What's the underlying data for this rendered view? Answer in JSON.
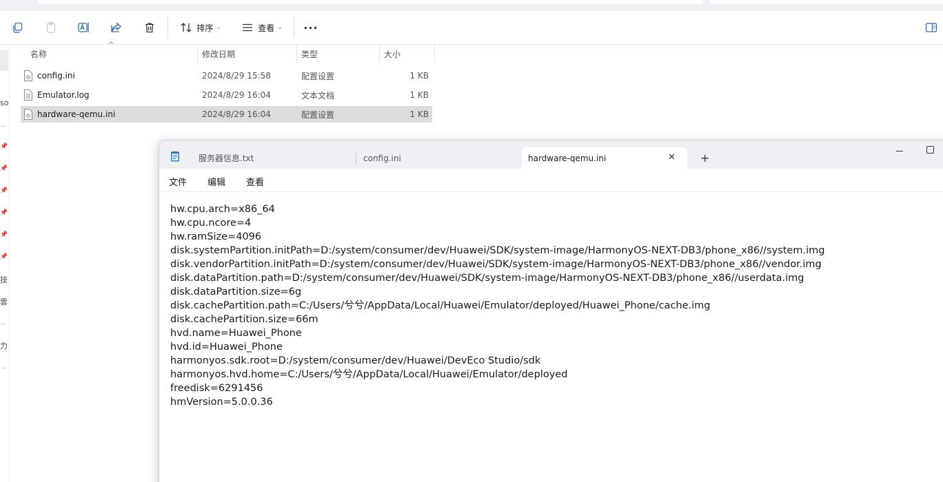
{
  "explorer": {
    "toolbar": {
      "copy_icon": "copy-icon",
      "paste_icon": "paste-icon",
      "rename_icon": "rename-icon",
      "share_icon": "share-icon",
      "delete_icon": "trash-icon",
      "sort_label": "排序",
      "view_label": "查看",
      "more_label": "···"
    },
    "columns": {
      "name": "名称",
      "modified": "修改日期",
      "type": "类型",
      "size": "大小"
    },
    "left_nav_fragments": [
      "so",
      "技",
      "雲",
      "力"
    ],
    "files": [
      {
        "name": "config.ini",
        "modified": "2024/8/29 15:58",
        "type": "配置设置",
        "size": "1 KB",
        "icon": "ini-file-icon",
        "selected": false
      },
      {
        "name": "Emulator.log",
        "modified": "2024/8/29 16:04",
        "type": "文本文档",
        "size": "1 KB",
        "icon": "text-file-icon",
        "selected": false
      },
      {
        "name": "hardware-qemu.ini",
        "modified": "2024/8/29 16:04",
        "type": "配置设置",
        "size": "1 KB",
        "icon": "ini-file-icon",
        "selected": true
      }
    ]
  },
  "notepad": {
    "tabs": [
      {
        "label": "服务器信息.txt",
        "active": false
      },
      {
        "label": "config.ini",
        "active": false
      },
      {
        "label": "hardware-qemu.ini",
        "active": true
      }
    ],
    "close_tab_glyph": "✕",
    "new_tab_glyph": "+",
    "menu": {
      "file": "文件",
      "edit": "编辑",
      "view": "查看"
    },
    "lines": [
      "hw.cpu.arch=x86_64",
      "hw.cpu.ncore=4",
      "hw.ramSize=4096",
      "disk.systemPartition.initPath=D:/system/consumer/dev/Huawei/SDK/system-image/HarmonyOS-NEXT-DB3/phone_x86//system.img",
      "disk.vendorPartition.initPath=D:/system/consumer/dev/Huawei/SDK/system-image/HarmonyOS-NEXT-DB3/phone_x86//vendor.img",
      "disk.dataPartition.path=D:/system/consumer/dev/Huawei/SDK/system-image/HarmonyOS-NEXT-DB3/phone_x86//userdata.img",
      "disk.dataPartition.size=6g",
      "disk.cachePartition.path=C:/Users/兮兮/AppData/Local/Huawei/Emulator/deployed/Huawei_Phone/cache.img",
      "disk.cachePartition.size=66m",
      "hvd.name=Huawei_Phone",
      "hvd.id=Huawei_Phone",
      "harmonyos.sdk.root=D:/system/consumer/dev/Huawei/DevEco Studio/sdk",
      "harmonyos.hvd.home=C:/Users/兮兮/AppData/Local/Huawei/Emulator/deployed",
      "freedisk=6291456",
      "hmVersion=5.0.0.36"
    ]
  }
}
